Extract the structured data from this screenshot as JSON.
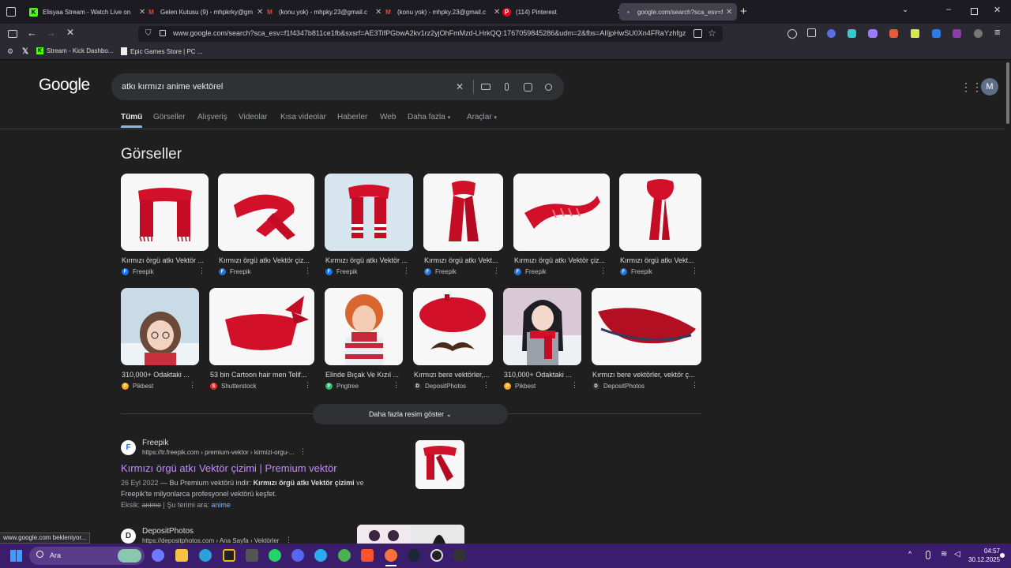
{
  "browser": {
    "tabs": [
      {
        "title": "Elisyaa Stream - Watch Live on",
        "icon": "kick-icon",
        "color": "#53fc18"
      },
      {
        "title": "Gelen Kutusu (9) - mhpkrky@gm",
        "icon": "gmail-icon",
        "color": "#ea4335"
      },
      {
        "title": "(konu yok) - mhpky.23@gmail.c",
        "icon": "gmail-icon",
        "color": "#ea4335"
      },
      {
        "title": "(konu yok) - mhpky.23@gmail.c",
        "icon": "gmail-icon",
        "color": "#ea4335"
      },
      {
        "title": "(114) Pinterest",
        "icon": "pinterest-icon",
        "color": "#e60023"
      },
      {
        "title": "google.com/search?sca_esv=f1",
        "icon": "loading-icon",
        "color": "#888"
      }
    ],
    "url": "www.google.com/search?sca_esv=f1f4347b811ce1fb&sxsrf=AE3TifPGbwA2kv1rz2yjOhFmMzd-LHrkQQ:1767059845286&udm=2&fbs=AIIjpHwSU0Xn4FRaYzhfgz",
    "bookmarks": [
      {
        "label": "",
        "icon": "x-icon"
      },
      {
        "label": "Stream - Kick Dashbo...",
        "icon": "kick-icon"
      },
      {
        "label": "Epic Games Store | PC ...",
        "icon": "epic-icon"
      }
    ],
    "status_text": "www.google.com bekleniyor..."
  },
  "google": {
    "logo": "Google",
    "query": "atkı kırmızı anime vektörel",
    "account_initial": "M",
    "tabs": [
      "Tümü",
      "Görseller",
      "Alışveriş",
      "Videolar",
      "Kısa videolar",
      "Haberler",
      "Web",
      "Daha fazla",
      "Araçlar"
    ],
    "images_heading": "Görseller",
    "images": [
      {
        "title": "Kırmızı örgü atkı Vektör ...",
        "source": "Freepik",
        "source_color": "#1a73e8"
      },
      {
        "title": "Kırmızı örgü atkı Vektör çiz...",
        "source": "Freepik",
        "source_color": "#1a73e8"
      },
      {
        "title": "Kırmızı örgü atkı Vektör ...",
        "source": "Freepik",
        "source_color": "#1a73e8"
      },
      {
        "title": "Kırmızı örgü atkı Vekt...",
        "source": "Freepik",
        "source_color": "#1a73e8"
      },
      {
        "title": "Kırmızı örgü atkı Vektör çiz...",
        "source": "Freepik",
        "source_color": "#1a73e8"
      },
      {
        "title": "Kırmızı örgü atkı Vekt...",
        "source": "Freepik",
        "source_color": "#1a73e8"
      },
      {
        "title": "310,000+ Odaktaki ...",
        "source": "Pikbest",
        "source_color": "#f5a623"
      },
      {
        "title": "53 bin Cartoon hair men Telif...",
        "source": "Shutterstock",
        "source_color": "#ee2b24"
      },
      {
        "title": "Elinde Bıçak Ve Kızıl ...",
        "source": "Pngtree",
        "source_color": "#2fb36d"
      },
      {
        "title": "Kırmızı bere vektörler,...",
        "source": "DepositPhotos",
        "source_color": "#333333"
      },
      {
        "title": "310,000+ Odaktaki ...",
        "source": "Pikbest",
        "source_color": "#f5a623"
      },
      {
        "title": "Kırmızı bere vektörler, vektör ç...",
        "source": "DepositPhotos",
        "source_color": "#333333"
      }
    ],
    "more_images_label": "Daha fazla resim göster",
    "results": [
      {
        "site": "Freepik",
        "url": "https://tr.freepik.com › premium-vektor › kirmizi-orgu-...",
        "title": "Kırmızı örgü atkı Vektör çizimi | Premium vektör",
        "snippet_date": "26 Eyl 2022",
        "snippet": " — Bu Premium vektörü indir: ",
        "snippet_bold": "Kırmızı örgü atkı Vektör çizimi",
        "snippet_tail": " ve Freepik'te milyonlarca profesyonel vektörü keşfet.",
        "missing_label": "Eksik:",
        "missing_word": "anime",
        "must_include_label": " | Şu terimi ara:",
        "must_include_word": "anime"
      },
      {
        "site": "DepositPhotos",
        "url": "https://depositphotos.com › Ana Sayfa › Vektörler"
      }
    ]
  },
  "taskbar": {
    "search_label": "Ara",
    "time": "04:57",
    "date": "30.12.2025"
  }
}
